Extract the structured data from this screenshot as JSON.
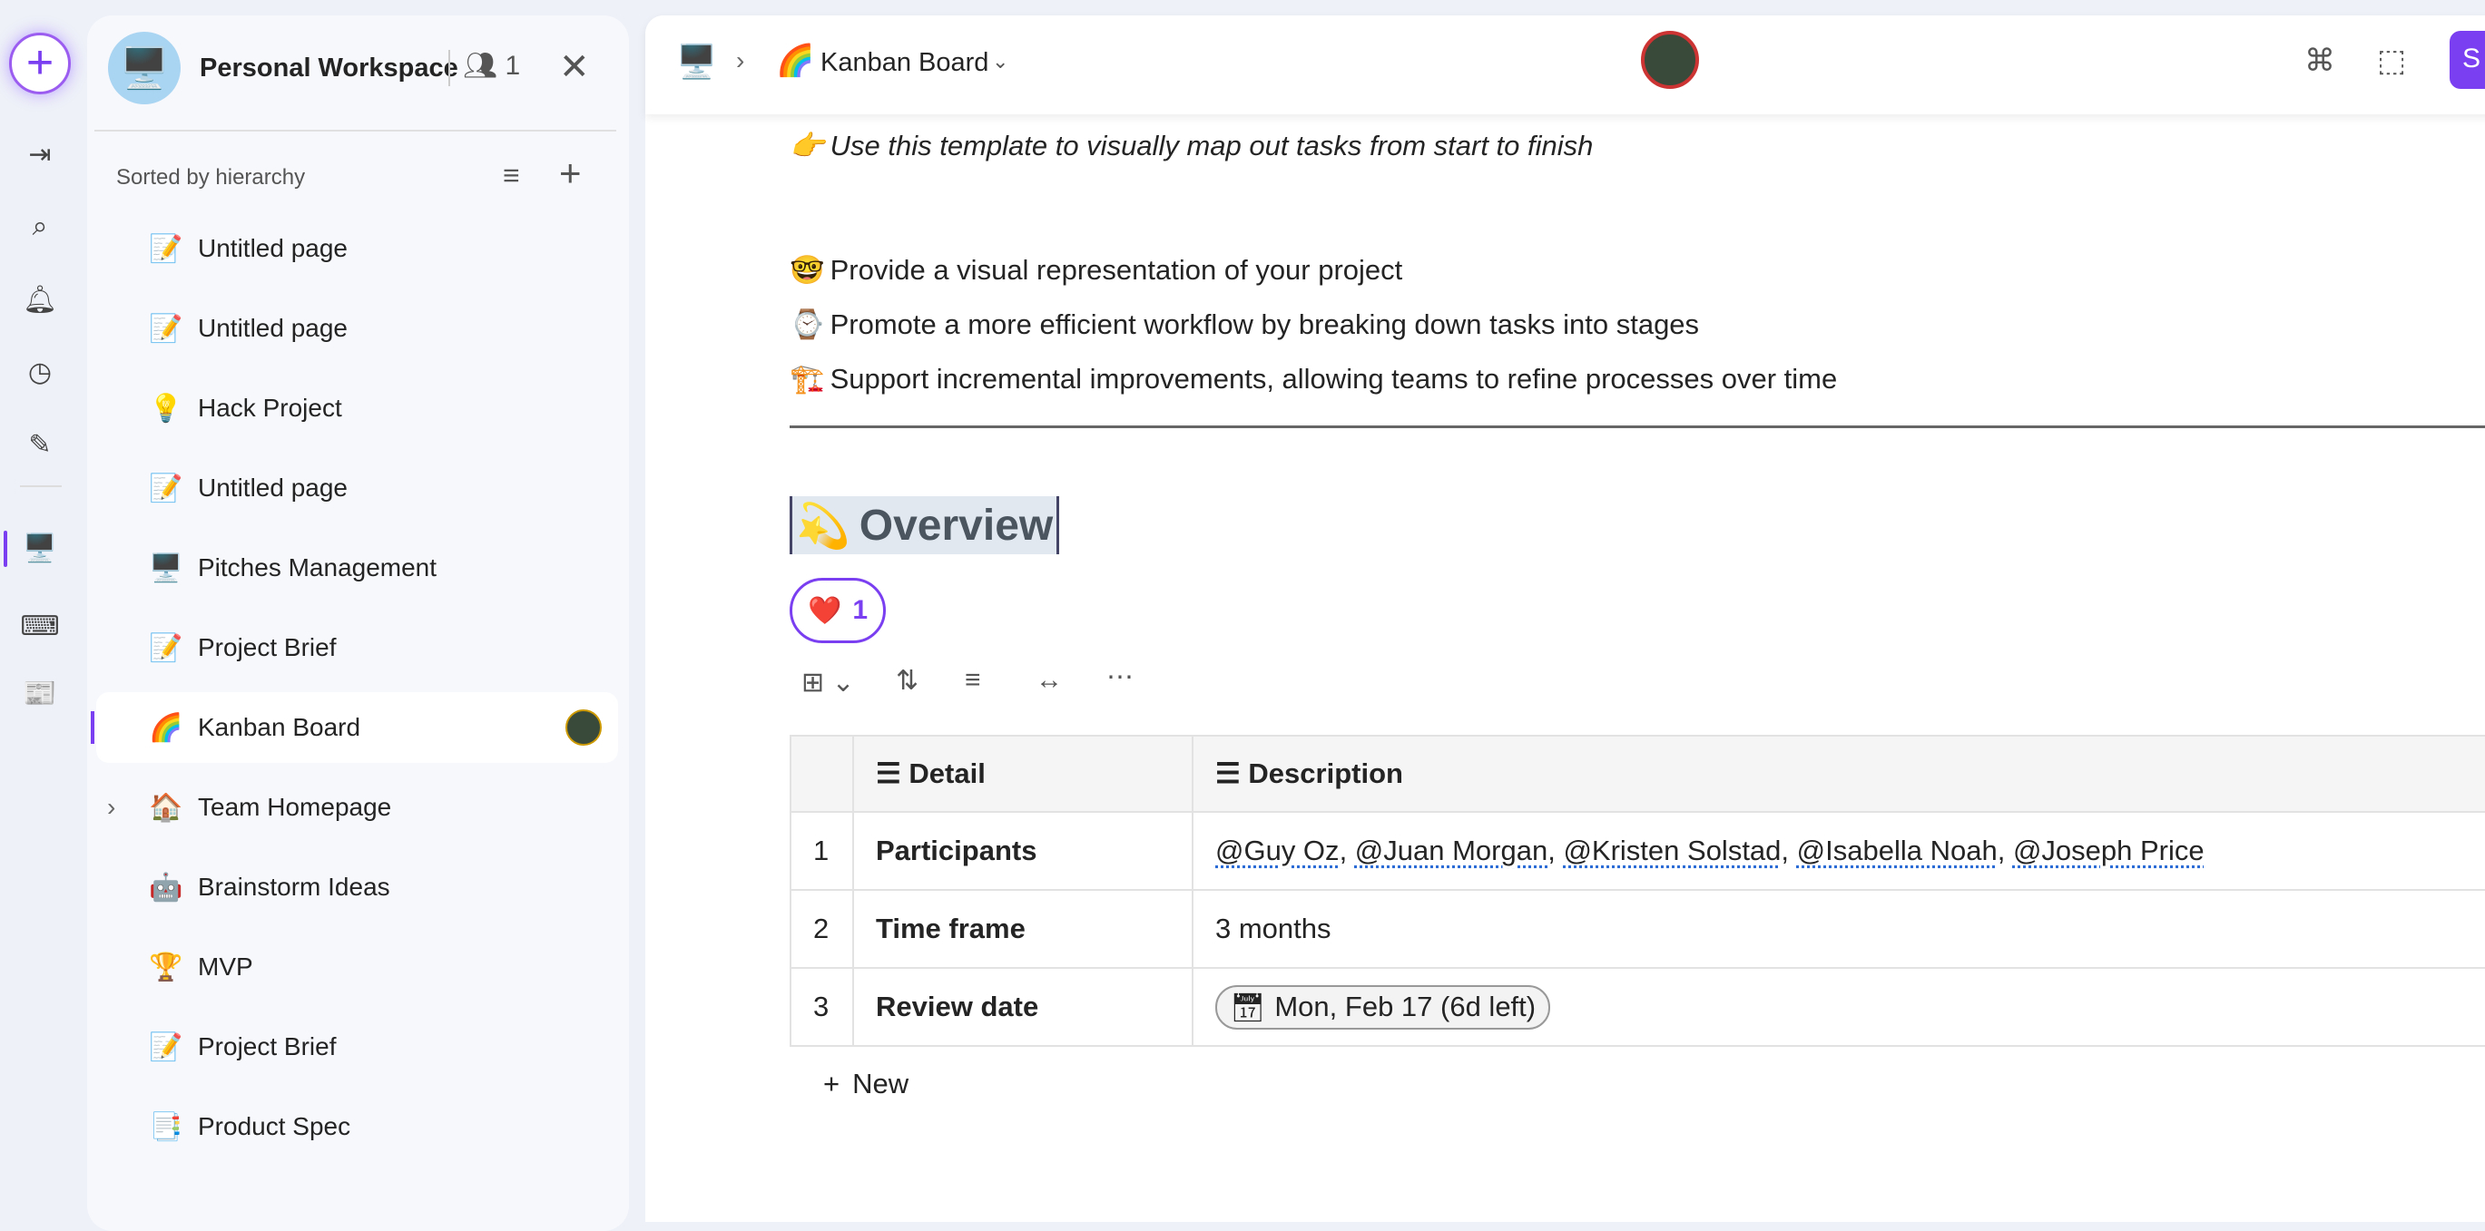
{
  "rail": {
    "items": [
      "new-icon",
      "sidebar-toggle-icon",
      "search-icon",
      "bell-icon",
      "clock-icon",
      "pen-icon",
      "workspace-icon",
      "keyboard-icon",
      "app-icon"
    ]
  },
  "sidebar": {
    "workspace": "Personal Workspace",
    "member_count": "1",
    "sort_label": "Sorted by hierarchy",
    "items": [
      {
        "icon": "📝",
        "label": "Untitled page"
      },
      {
        "icon": "📝",
        "label": "Untitled page"
      },
      {
        "icon": "💡",
        "label": "Hack Project"
      },
      {
        "icon": "📝",
        "label": "Untitled page"
      },
      {
        "icon": "🖥️",
        "label": "Pitches Management"
      },
      {
        "icon": "📝",
        "label": "Project Brief"
      },
      {
        "icon": "🌈",
        "label": "Kanban Board"
      },
      {
        "icon": "🏠",
        "label": "Team Homepage"
      },
      {
        "icon": "🤖",
        "label": "Brainstorm Ideas"
      },
      {
        "icon": "🏆",
        "label": "MVP"
      },
      {
        "icon": "📝",
        "label": "Project Brief"
      },
      {
        "icon": "📑",
        "label": "Product Spec"
      }
    ],
    "active_index": 6
  },
  "header": {
    "breadcrumb_icon": "🖥️",
    "page_icon": "🌈",
    "page_title": "Kanban Board",
    "share_label": "S"
  },
  "content": {
    "intro": {
      "icon": "👉",
      "text": "Use this template to visually map out tasks from start to finish"
    },
    "bullets": [
      {
        "icon": "🤓",
        "text": "Provide a visual representation of your project"
      },
      {
        "icon": "⌚",
        "text": "Promote a more efficient workflow by breaking down tasks into stages"
      },
      {
        "icon": "🏗️",
        "text": "Support incremental improvements, allowing teams to refine processes over time"
      }
    ],
    "heading": {
      "icon": "💫",
      "text": "Overview"
    },
    "reaction": {
      "icon": "❤️",
      "count": "1"
    },
    "table": {
      "columns": [
        "Detail",
        "Description"
      ],
      "rows": [
        {
          "num": "1",
          "detail": "Participants",
          "mentions": [
            "@Guy Oz",
            "@Juan Morgan",
            "@Kristen Solstad",
            "@Isabella Noah",
            "@Joseph Price"
          ]
        },
        {
          "num": "2",
          "detail": "Time frame",
          "value": "3 months"
        },
        {
          "num": "3",
          "detail": "Review date",
          "date": "Mon, Feb 17 (6d left)"
        }
      ]
    },
    "new_label": "New"
  },
  "colors": {
    "accent": "#7a3ff0"
  }
}
